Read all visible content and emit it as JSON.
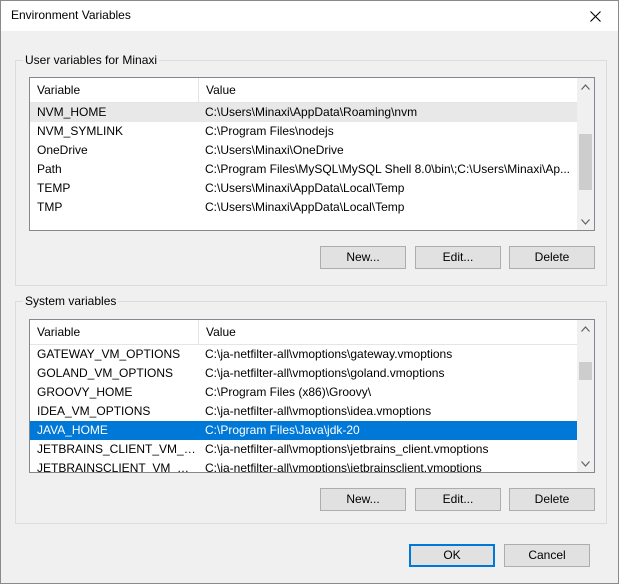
{
  "window": {
    "title": "Environment Variables"
  },
  "user_vars": {
    "label": "User variables for Minaxi",
    "headers": {
      "variable": "Variable",
      "value": "Value"
    },
    "rows": [
      {
        "name": "NVM_HOME",
        "value": "C:\\Users\\Minaxi\\AppData\\Roaming\\nvm"
      },
      {
        "name": "NVM_SYMLINK",
        "value": "C:\\Program Files\\nodejs"
      },
      {
        "name": "OneDrive",
        "value": "C:\\Users\\Minaxi\\OneDrive"
      },
      {
        "name": "Path",
        "value": "C:\\Program Files\\MySQL\\MySQL Shell 8.0\\bin\\;C:\\Users\\Minaxi\\Ap..."
      },
      {
        "name": "TEMP",
        "value": "C:\\Users\\Minaxi\\AppData\\Local\\Temp"
      },
      {
        "name": "TMP",
        "value": "C:\\Users\\Minaxi\\AppData\\Local\\Temp"
      }
    ],
    "buttons": {
      "new": "New...",
      "edit": "Edit...",
      "delete": "Delete"
    }
  },
  "system_vars": {
    "label": "System variables",
    "headers": {
      "variable": "Variable",
      "value": "Value"
    },
    "rows": [
      {
        "name": "GATEWAY_VM_OPTIONS",
        "value": "C:\\ja-netfilter-all\\vmoptions\\gateway.vmoptions"
      },
      {
        "name": "GOLAND_VM_OPTIONS",
        "value": "C:\\ja-netfilter-all\\vmoptions\\goland.vmoptions"
      },
      {
        "name": "GROOVY_HOME",
        "value": "C:\\Program Files (x86)\\Groovy\\"
      },
      {
        "name": "IDEA_VM_OPTIONS",
        "value": "C:\\ja-netfilter-all\\vmoptions\\idea.vmoptions"
      },
      {
        "name": "JAVA_HOME",
        "value": "C:\\Program Files\\Java\\jdk-20"
      },
      {
        "name": "JETBRAINS_CLIENT_VM_OPT...",
        "value": "C:\\ja-netfilter-all\\vmoptions\\jetbrains_client.vmoptions"
      },
      {
        "name": "JETBRAINSCLIENT_VM_OPTI...",
        "value": "C:\\ja-netfilter-all\\vmoptions\\jetbrainsclient.vmoptions"
      }
    ],
    "buttons": {
      "new": "New...",
      "edit": "Edit...",
      "delete": "Delete"
    }
  },
  "footer": {
    "ok": "OK",
    "cancel": "Cancel"
  },
  "colors": {
    "selection": "#0078d7",
    "dialog_bg": "#f0f0f0",
    "button_bg": "#e1e1e1"
  },
  "icons": {
    "close": "close-icon",
    "scroll_up": "chevron-up-icon",
    "scroll_down": "chevron-down-icon"
  }
}
